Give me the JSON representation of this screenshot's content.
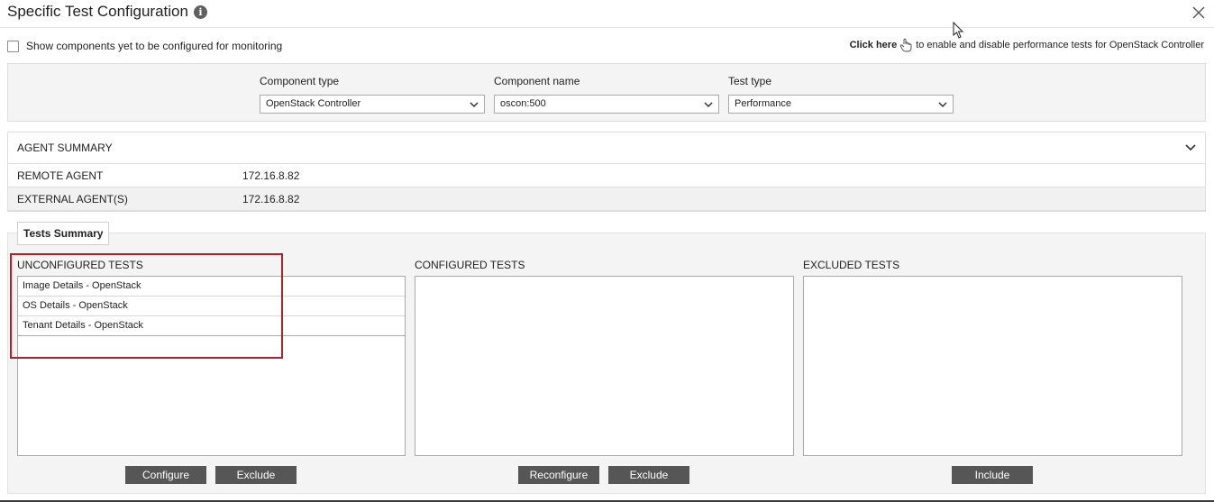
{
  "dialog": {
    "title": "Specific Test Configuration",
    "info_icon": "info-circle-icon",
    "close_icon": "close-icon"
  },
  "show_components": {
    "label": "Show components yet to be configured for monitoring",
    "checked": false
  },
  "click_here": {
    "link": "Click here",
    "text": "to enable and disable performance tests for OpenStack Controller"
  },
  "config": {
    "component_type": {
      "label": "Component type",
      "value": "OpenStack Controller"
    },
    "component_name": {
      "label": "Component name",
      "value": "oscon:500"
    },
    "test_type": {
      "label": "Test type",
      "value": "Performance"
    }
  },
  "agent_summary": {
    "header": "AGENT SUMMARY",
    "rows": [
      {
        "key": "REMOTE AGENT",
        "value": "172.16.8.82"
      },
      {
        "key": "EXTERNAL AGENT(S)",
        "value": "172.16.8.82"
      }
    ]
  },
  "tests_summary": {
    "tab": "Tests Summary",
    "unconfigured": {
      "title": "UNCONFIGURED TESTS",
      "items": [
        "Image Details - OpenStack",
        "OS Details - OpenStack",
        "Tenant Details - OpenStack"
      ],
      "buttons": {
        "configure": "Configure",
        "exclude": "Exclude"
      }
    },
    "configured": {
      "title": "CONFIGURED TESTS",
      "items": [],
      "buttons": {
        "reconfigure": "Reconfigure",
        "exclude": "Exclude"
      }
    },
    "excluded": {
      "title": "EXCLUDED TESTS",
      "items": [],
      "buttons": {
        "include": "Include"
      }
    }
  },
  "colors": {
    "button_bg": "#565656",
    "highlight": "#b3202a",
    "panel_bg": "#f4f4f4"
  }
}
